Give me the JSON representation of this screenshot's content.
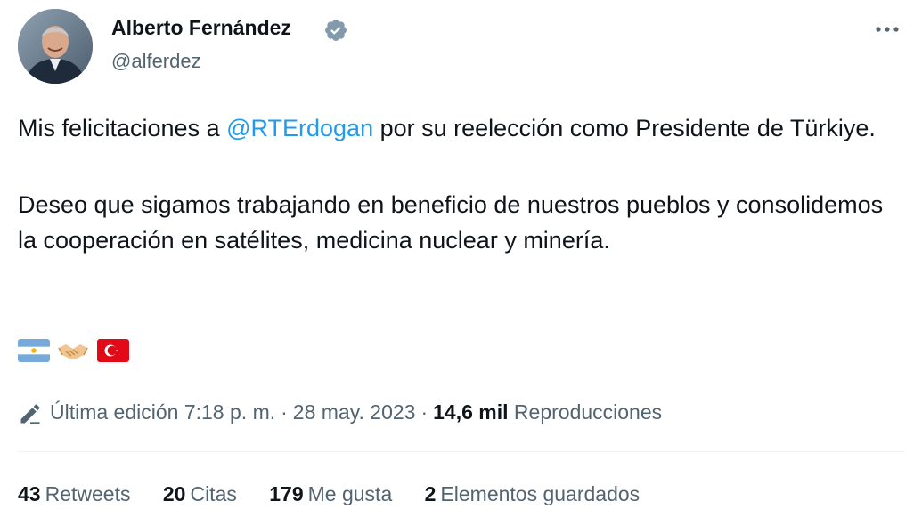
{
  "author": {
    "name": "Alberto Fernández",
    "handle": "@alferdez",
    "verified": true
  },
  "tweet": {
    "line1_before": "Mis felicitaciones a ",
    "mention": "@RTErdogan",
    "line1_after": " por su reelección como Presidente de Türkiye.",
    "paragraph2": "Deseo que sigamos trabajando en beneficio de nuestros pueblos y consolidemos la cooperación en satélites, medicina nuclear y minería.",
    "emojis": [
      "flag-argentina-icon",
      "handshake-icon",
      "flag-turkey-icon"
    ]
  },
  "meta": {
    "edited_label": "Última edición 7:18 p. m.",
    "separator": "·",
    "date": "28 may. 2023",
    "views_count": "14,6 mil",
    "views_label": "Reproducciones"
  },
  "stats": {
    "retweets": {
      "count": "43",
      "label": "Retweets"
    },
    "quotes": {
      "count": "20",
      "label": "Citas"
    },
    "likes": {
      "count": "179",
      "label": "Me gusta"
    },
    "bookmarks": {
      "count": "2",
      "label": "Elementos guardados"
    }
  },
  "colors": {
    "text": "#0f1419",
    "secondary": "#536471",
    "accent": "#1d9bf0",
    "divider": "#eff3f4"
  }
}
